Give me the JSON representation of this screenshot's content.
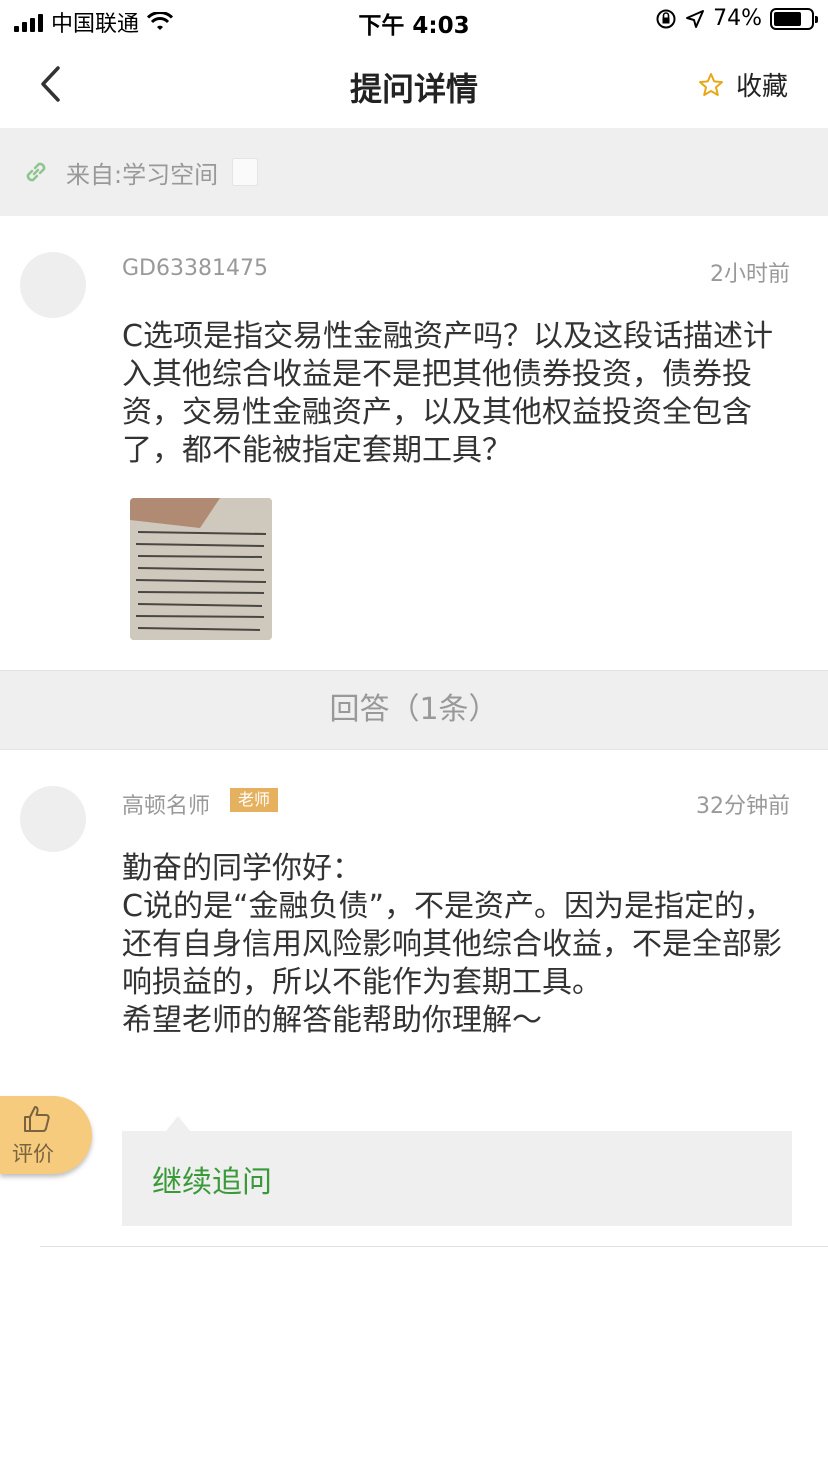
{
  "status_bar": {
    "carrier": "中国联通",
    "time": "下午 4:03",
    "battery_percent": "74%",
    "battery_level": 0.74
  },
  "nav": {
    "title": "提问详情",
    "favorite_label": "收藏",
    "icons": {
      "back": "chevron-left-icon",
      "favorite": "star-outline-icon"
    },
    "accent_color": "#e6a817"
  },
  "source": {
    "text": "来自:学习空间",
    "icons": {
      "link": "link-icon",
      "doc": "document-icon"
    },
    "link_color": "#8ec48e"
  },
  "question": {
    "user_id": "GD63381475",
    "time": "2小时前",
    "text": "C选项是指交易性金融资产吗？以及这段话描述计入其他综合收益是不是把其他债券投资，债券投资，交易性金融资产，以及其他权益投资全包含了，都不能被指定套期工具？"
  },
  "answers": {
    "header": "回答（1条）"
  },
  "answer": {
    "teacher_name": "高顿名师",
    "badge": "老师",
    "time": "32分钟前",
    "lines": [
      "勤奋的同学你好：",
      "C说的是“金融负债”，不是资产。因为是指定的，还有自身信用风险影响其他综合收益，不是全部影响损益的，所以不能作为套期工具。",
      "希望老师的解答能帮助你理解～"
    ]
  },
  "rate": {
    "label": "评价",
    "icon": "thumbs-up-icon",
    "color": "#f6cb7d"
  },
  "followup": {
    "label": "继续追问",
    "color": "#3a9a3a"
  }
}
